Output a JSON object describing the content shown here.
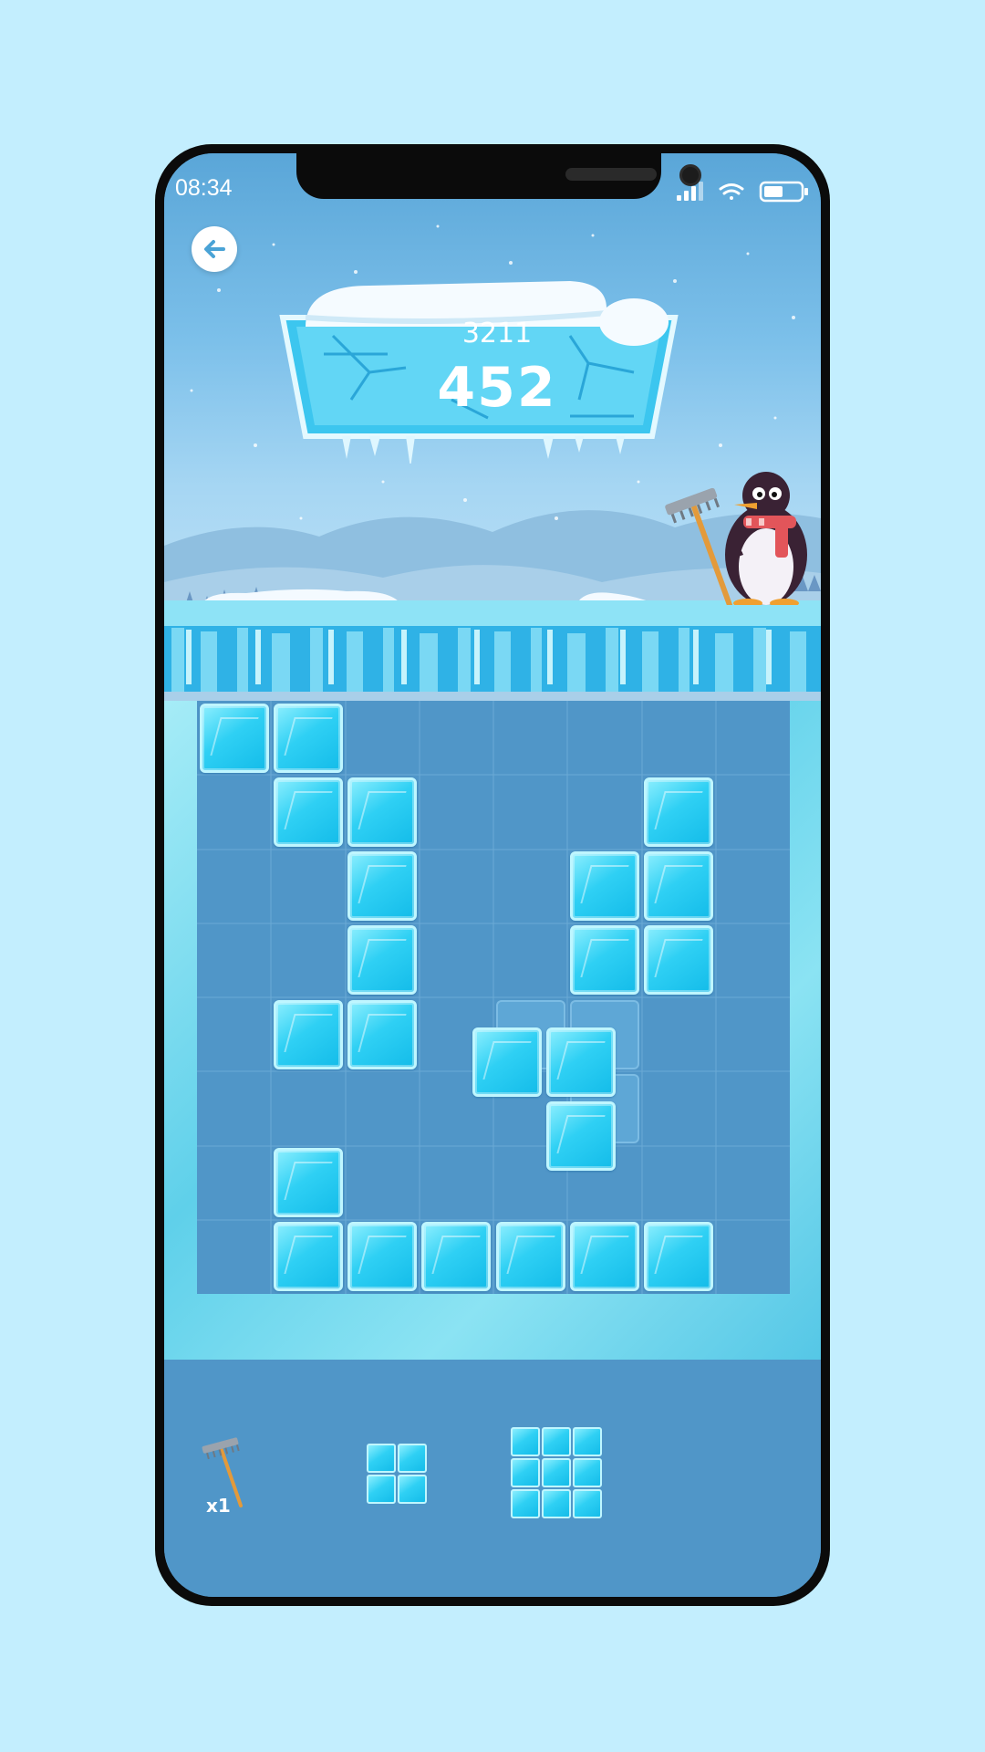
{
  "status_bar": {
    "time": "08:34"
  },
  "game": {
    "best_score": "3211",
    "current_score": "452"
  },
  "board": {
    "rows": 8,
    "cols": 8,
    "filled_cells": [
      [
        0,
        0
      ],
      [
        0,
        1
      ],
      [
        1,
        1
      ],
      [
        1,
        2
      ],
      [
        1,
        6
      ],
      [
        2,
        2
      ],
      [
        2,
        5
      ],
      [
        2,
        6
      ],
      [
        3,
        2
      ],
      [
        3,
        5
      ],
      [
        3,
        6
      ],
      [
        4,
        1
      ],
      [
        4,
        2
      ],
      [
        6,
        1
      ],
      [
        7,
        1
      ],
      [
        7,
        2
      ],
      [
        7,
        3
      ],
      [
        7,
        4
      ],
      [
        7,
        5
      ],
      [
        7,
        6
      ]
    ],
    "ghost_piece_cells": [
      [
        4,
        4
      ],
      [
        4,
        5
      ],
      [
        5,
        5
      ]
    ],
    "dragged_piece_cells": [
      [
        0,
        0
      ],
      [
        0,
        1
      ],
      [
        1,
        1
      ]
    ]
  },
  "tools": {
    "rake": {
      "count_label": "x1"
    }
  },
  "piece_tray": [
    {
      "rows": 2,
      "cols": 2
    },
    {
      "rows": 3,
      "cols": 3
    }
  ],
  "colors": {
    "background": "#c3eefe",
    "board": "#5096c8",
    "ice_block": "#2fd0f4"
  }
}
